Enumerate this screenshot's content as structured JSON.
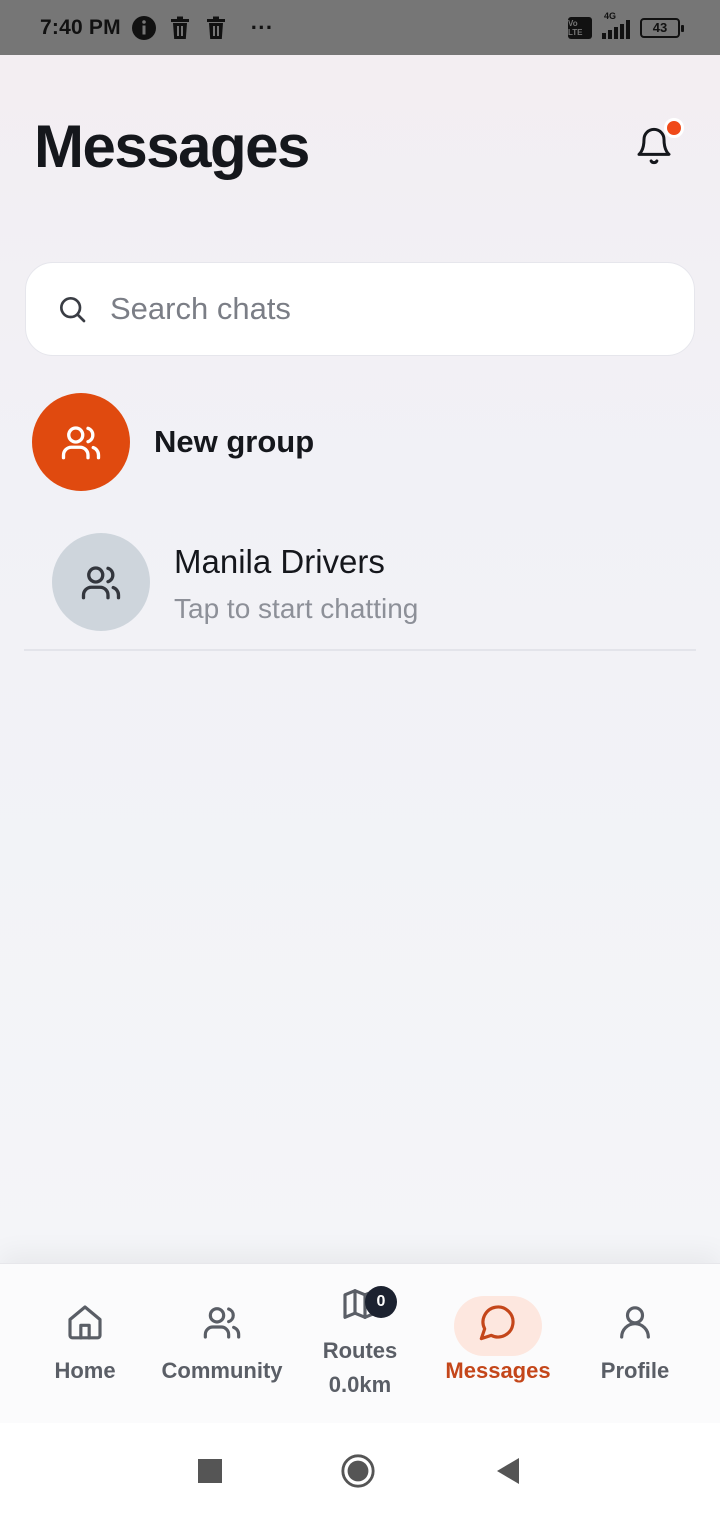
{
  "status_bar": {
    "time": "7:40 PM",
    "battery": "43",
    "network": "4G",
    "volte": "Vo LTE",
    "more": "···"
  },
  "header": {
    "title": "Messages"
  },
  "search": {
    "placeholder": "Search chats",
    "value": ""
  },
  "new_group": {
    "label": "New group"
  },
  "chats": [
    {
      "name": "Manila Drivers",
      "preview": "Tap to start chatting"
    }
  ],
  "bottom_nav": {
    "items": [
      {
        "label": "Home",
        "icon": "home-icon"
      },
      {
        "label": "Community",
        "icon": "community-icon"
      },
      {
        "label": "Routes",
        "sublabel": "0.0km",
        "badge": "0",
        "icon": "map-icon"
      },
      {
        "label": "Messages",
        "icon": "chat-bubble-icon",
        "active": true
      },
      {
        "label": "Profile",
        "icon": "user-icon"
      }
    ]
  },
  "colors": {
    "accent": "#e04a0f",
    "active_nav": "#c4461a",
    "notification_dot": "#f04a1a",
    "avatar_grey": "#ced5dc"
  }
}
